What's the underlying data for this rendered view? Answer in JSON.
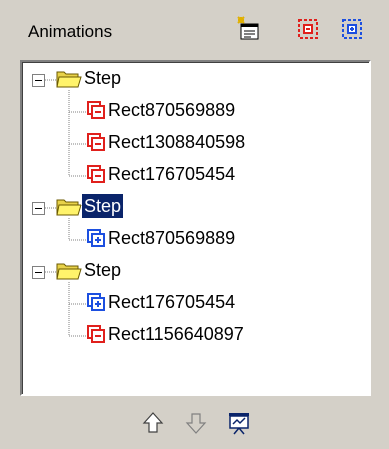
{
  "panel": {
    "title": "Animations",
    "toolbar": [
      {
        "icon": "add-step-icon"
      },
      {
        "icon": "add-exit-animation-icon"
      },
      {
        "icon": "add-entrance-animation-icon"
      }
    ]
  },
  "tree": {
    "nodes": [
      {
        "type": "step",
        "label": "Step",
        "selected": false,
        "children": [
          {
            "type": "exit",
            "label": "Rect870569889"
          },
          {
            "type": "exit",
            "label": "Rect1308840598"
          },
          {
            "type": "exit",
            "label": "Rect176705454"
          }
        ]
      },
      {
        "type": "step",
        "label": "Step",
        "selected": true,
        "children": [
          {
            "type": "entrance",
            "label": "Rect870569889"
          }
        ]
      },
      {
        "type": "step",
        "label": "Step",
        "selected": false,
        "children": [
          {
            "type": "entrance",
            "label": "Rect176705454"
          },
          {
            "type": "exit",
            "label": "Rect1156640897"
          }
        ]
      }
    ]
  },
  "footer": {
    "buttons": [
      {
        "icon": "move-up-icon"
      },
      {
        "icon": "move-down-icon"
      },
      {
        "icon": "preview-presentation-icon"
      }
    ]
  },
  "colors": {
    "exit": "#e0201c",
    "entrance": "#1c4fe0",
    "selection": "#0a246a",
    "panel_bg": "#d4d0c8"
  }
}
